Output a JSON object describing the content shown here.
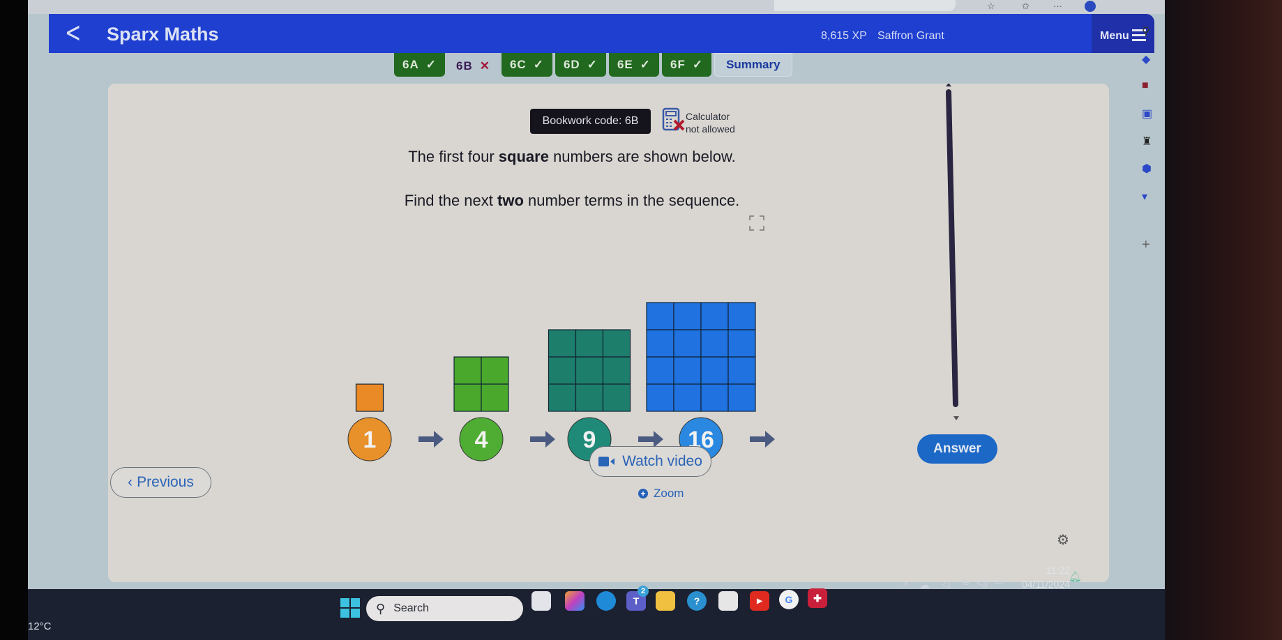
{
  "browser": {
    "icons": [
      "star-icon",
      "favorites-icon",
      "more-icon",
      "profile-icon"
    ]
  },
  "header": {
    "back_icon": "chevron-left-icon",
    "title": "Sparx Maths",
    "xp": "8,615 XP",
    "user_name": "Saffron Grant",
    "menu_label": "Menu"
  },
  "tabs": [
    {
      "label": "6A",
      "status": "correct",
      "mark": "✓"
    },
    {
      "label": "6B",
      "status": "incorrect",
      "mark": "✕"
    },
    {
      "label": "6C",
      "status": "correct",
      "mark": "✓"
    },
    {
      "label": "6D",
      "status": "correct",
      "mark": "✓"
    },
    {
      "label": "6E",
      "status": "correct",
      "mark": "✓"
    },
    {
      "label": "6F",
      "status": "correct",
      "mark": "✓"
    },
    {
      "label": "Summary",
      "status": "summary",
      "mark": ""
    }
  ],
  "question": {
    "bookwork_code": "Bookwork code: 6B",
    "calculator_line1": "Calculator",
    "calculator_line2": "not allowed",
    "line1_pre": "The first four ",
    "line1_bold": "square",
    "line1_post": " numbers are shown below.",
    "line2_pre": "Find the next ",
    "line2_bold": "two",
    "line2_post": " number terms in the sequence."
  },
  "sequence": [
    {
      "value": "1",
      "size": 1,
      "color": "#e98a26",
      "circle": "#e8902a"
    },
    {
      "value": "4",
      "size": 2,
      "color": "#4aa82d",
      "circle": "#4fad33"
    },
    {
      "value": "9",
      "size": 3,
      "color": "#1d7e6c",
      "circle": "#1f8a78"
    },
    {
      "value": "16",
      "size": 4,
      "color": "#1f72e0",
      "circle": "#2a88e0"
    }
  ],
  "actions": {
    "zoom_label": "Zoom",
    "watch_video_label": "Watch video",
    "previous_label": "Previous",
    "answer_label": "Answer"
  },
  "accent": {
    "header_blue": "#1f3fd0",
    "correct_green": "#21691e",
    "link_blue": "#2a64b7",
    "answer_blue": "#1c68c6"
  },
  "taskbar": {
    "weather": "12°C",
    "search_placeholder": "Search",
    "teams_badge": "2",
    "time": "11:22",
    "date": "04/11/2024"
  }
}
